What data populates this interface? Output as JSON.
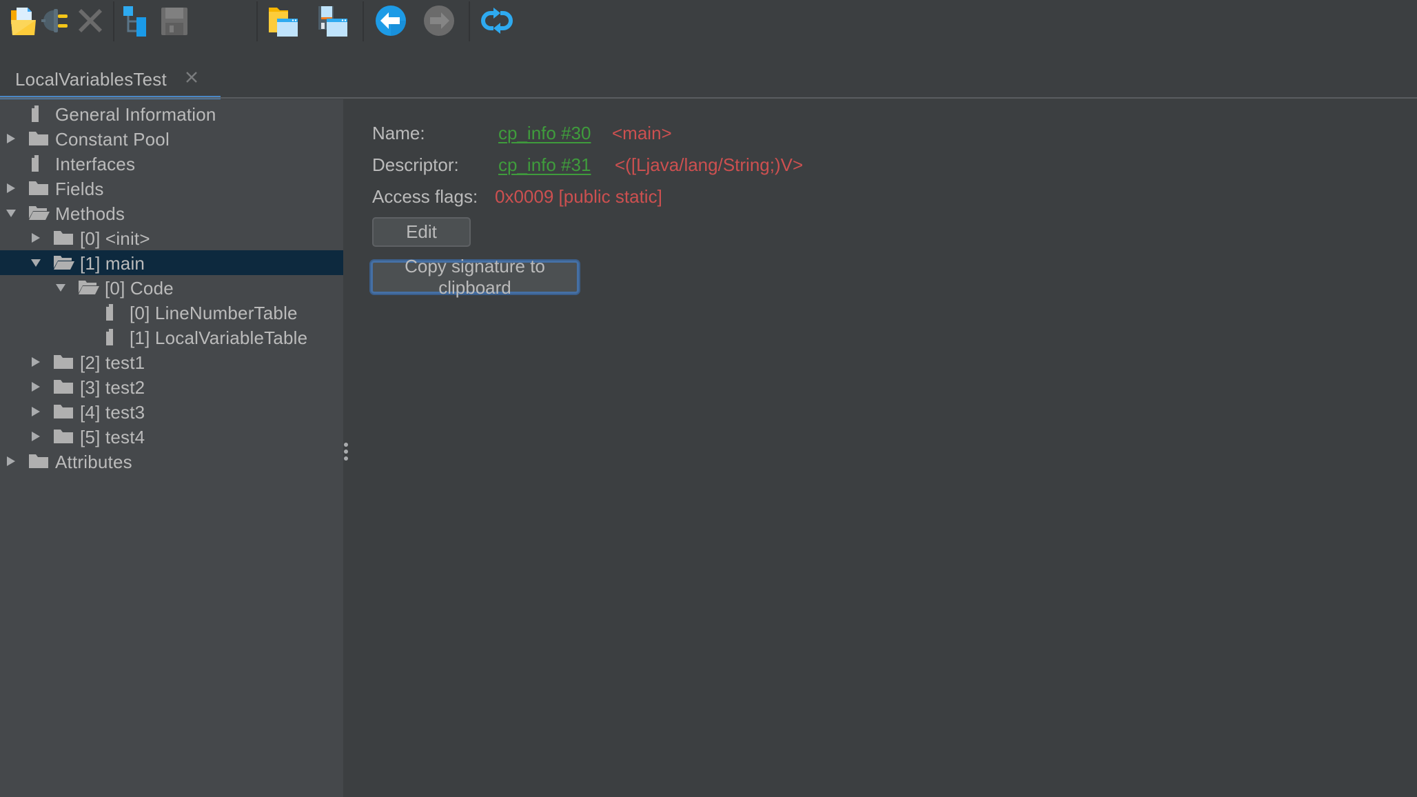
{
  "toolbar": {
    "buttons": [
      {
        "name": "open-file",
        "icon": "open-folder-icon",
        "enabled": true
      },
      {
        "name": "connect",
        "icon": "plug-icon",
        "enabled": true
      },
      {
        "name": "close",
        "icon": "close-x-icon",
        "enabled": false
      },
      {
        "name": "tree-view",
        "icon": "hierarchy-icon",
        "enabled": true
      },
      {
        "name": "save",
        "icon": "floppy-disk-icon",
        "enabled": false
      },
      {
        "name": "open-window",
        "icon": "folder-window-icon",
        "enabled": true
      },
      {
        "name": "save-window",
        "icon": "save-window-icon",
        "enabled": true
      },
      {
        "name": "back",
        "icon": "arrow-left-icon",
        "enabled": true
      },
      {
        "name": "forward",
        "icon": "arrow-right-icon",
        "enabled": false
      },
      {
        "name": "reload",
        "icon": "refresh-icon",
        "enabled": true
      }
    ]
  },
  "tabs": [
    {
      "label": "LocalVariablesTest",
      "active": true,
      "close_icon": "close-icon"
    }
  ],
  "tree": {
    "items": [
      {
        "label": "General Information",
        "level": 0,
        "type": "leaf",
        "expanded": null,
        "selected": false
      },
      {
        "label": "Constant Pool",
        "level": 0,
        "type": "folder",
        "expanded": false,
        "selected": false
      },
      {
        "label": "Interfaces",
        "level": 0,
        "type": "leaf",
        "expanded": null,
        "selected": false
      },
      {
        "label": "Fields",
        "level": 0,
        "type": "folder",
        "expanded": false,
        "selected": false
      },
      {
        "label": "Methods",
        "level": 0,
        "type": "folder",
        "expanded": true,
        "selected": false
      },
      {
        "label": "[0] <init>",
        "level": 1,
        "type": "folder",
        "expanded": false,
        "selected": false
      },
      {
        "label": "[1] main",
        "level": 1,
        "type": "folder",
        "expanded": true,
        "selected": true
      },
      {
        "label": "[0] Code",
        "level": 2,
        "type": "folder",
        "expanded": true,
        "selected": false
      },
      {
        "label": "[0] LineNumberTable",
        "level": 3,
        "type": "leaf",
        "expanded": null,
        "selected": false
      },
      {
        "label": "[1] LocalVariableTable",
        "level": 3,
        "type": "leaf",
        "expanded": null,
        "selected": false
      },
      {
        "label": "[2] test1",
        "level": 1,
        "type": "folder",
        "expanded": false,
        "selected": false
      },
      {
        "label": "[3] test2",
        "level": 1,
        "type": "folder",
        "expanded": false,
        "selected": false
      },
      {
        "label": "[4] test3",
        "level": 1,
        "type": "folder",
        "expanded": false,
        "selected": false
      },
      {
        "label": "[5] test4",
        "level": 1,
        "type": "folder",
        "expanded": false,
        "selected": false
      },
      {
        "label": "Attributes",
        "level": 0,
        "type": "folder",
        "expanded": false,
        "selected": false
      }
    ]
  },
  "detail": {
    "name": {
      "label": "Name:",
      "link": "cp_info #30",
      "value": "<main>"
    },
    "descriptor": {
      "label": "Descriptor:",
      "link": "cp_info #31",
      "value": "<([Ljava/lang/String;)V>"
    },
    "access_flags": {
      "label": "Access flags:",
      "value": "0x0009 [public static]"
    },
    "edit_button": "Edit",
    "copy_button": "Copy signature to clipboard"
  },
  "colors": {
    "link_green": "#3f9c3c",
    "value_red": "#cd5050",
    "selection": "#0d293e",
    "tab_accent": "#4a88c7"
  }
}
